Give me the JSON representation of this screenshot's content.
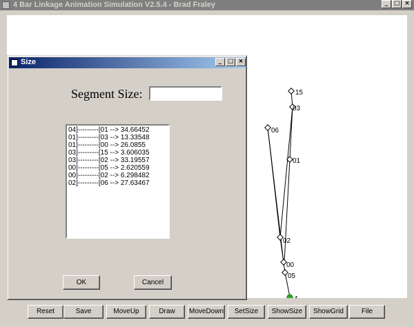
{
  "window": {
    "title": "4 Bar Linkage Animation Simulation V2.5.4 - Brad Fraley",
    "controls": [
      "_",
      "□",
      "×"
    ]
  },
  "dialog": {
    "title": "Size",
    "controls": [
      "_",
      "□",
      "×"
    ],
    "segment_label": "Segment Size:",
    "segment_value": "",
    "list_items": [
      "04]---------[01 --> 34.66452",
      "01]---------[03 --> 13.33548",
      "01]---------[00 --> 26.0855",
      "03]---------[15 --> 3.606035",
      "03]---------[02 --> 33.19557",
      "00]---------[05 --> 2.620559",
      "00]---------[02 --> 6.298482",
      "02]---------[06 --> 27.63467"
    ],
    "ok_label": "OK",
    "cancel_label": "Cancel"
  },
  "toolbar": {
    "buttons": [
      "Reset",
      "Save",
      "MoveUp",
      "Draw",
      "MoveDown",
      "SetSize",
      "ShowSize",
      "ShowGrid",
      "File"
    ]
  },
  "linkage": {
    "node_labels": [
      "15",
      "03",
      "06",
      "01",
      "02",
      "00",
      "05",
      "4"
    ],
    "node_color": "#ffffff",
    "ground_color": "#22aa22",
    "line_color": "#000000"
  }
}
